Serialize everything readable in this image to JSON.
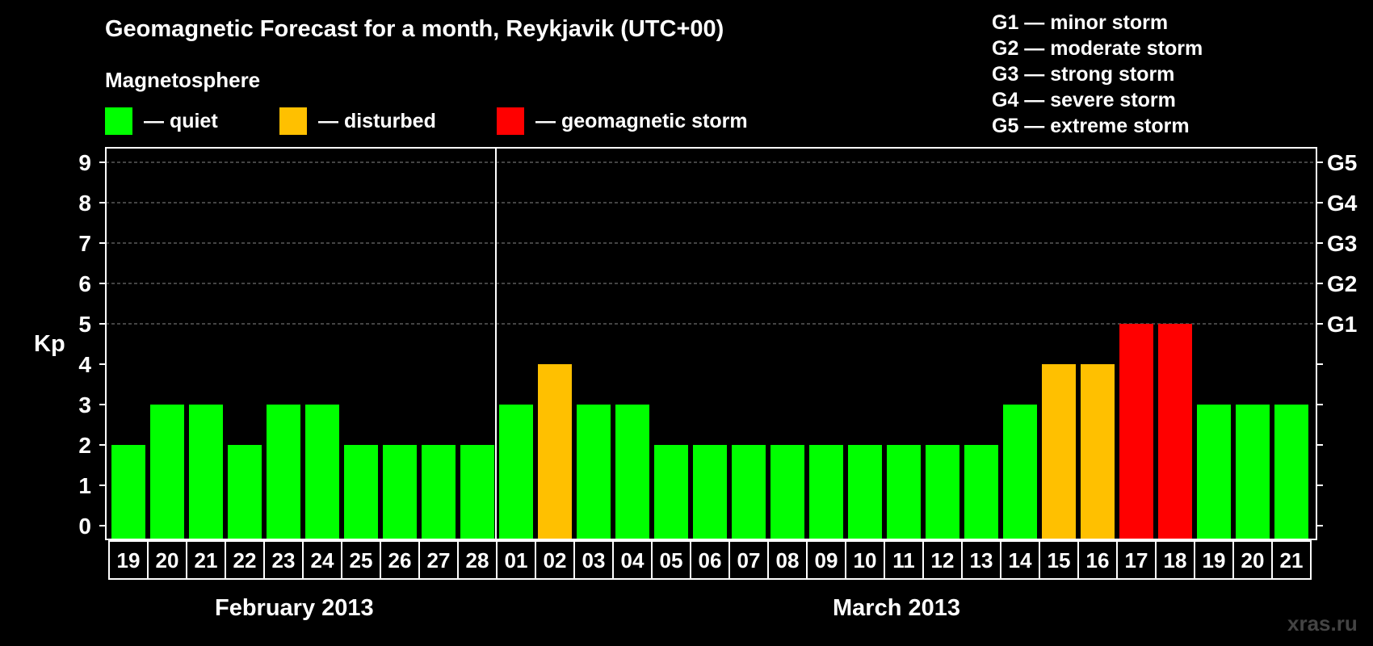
{
  "title": "Geomagnetic Forecast for a month, Reykjavik (UTC+00)",
  "legend": {
    "heading": "Magnetosphere",
    "items": [
      {
        "label": "— quiet",
        "color": "#00ff00"
      },
      {
        "label": "— disturbed",
        "color": "#ffc000"
      },
      {
        "label": "— geomagnetic storm",
        "color": "#ff0000"
      }
    ]
  },
  "storm_scale": [
    "G1 — minor storm",
    "G2 — moderate storm",
    "G3 — strong storm",
    "G4 — severe storm",
    "G5 — extreme storm"
  ],
  "months": [
    "February 2013",
    "March 2013"
  ],
  "watermark": "xras.ru",
  "chart_data": {
    "type": "bar",
    "ylabel": "Kp",
    "ylim": [
      0,
      9
    ],
    "grid": true,
    "yticks": [
      0,
      1,
      2,
      3,
      4,
      5,
      6,
      7,
      8,
      9
    ],
    "right_labels": [
      {
        "kp": 5,
        "label": "G1"
      },
      {
        "kp": 6,
        "label": "G2"
      },
      {
        "kp": 7,
        "label": "G3"
      },
      {
        "kp": 8,
        "label": "G4"
      },
      {
        "kp": 9,
        "label": "G5"
      }
    ],
    "categories": [
      "19",
      "20",
      "21",
      "22",
      "23",
      "24",
      "25",
      "26",
      "27",
      "28",
      "01",
      "02",
      "03",
      "04",
      "05",
      "06",
      "07",
      "08",
      "09",
      "10",
      "11",
      "12",
      "13",
      "14",
      "15",
      "16",
      "17",
      "18",
      "19",
      "20",
      "21"
    ],
    "values": [
      2,
      3,
      3,
      2,
      3,
      3,
      2,
      2,
      2,
      2,
      3,
      4,
      3,
      3,
      2,
      2,
      2,
      2,
      2,
      2,
      2,
      2,
      2,
      3,
      4,
      4,
      5,
      5,
      3,
      3,
      3
    ],
    "status": [
      "quiet",
      "quiet",
      "quiet",
      "quiet",
      "quiet",
      "quiet",
      "quiet",
      "quiet",
      "quiet",
      "quiet",
      "quiet",
      "disturbed",
      "quiet",
      "quiet",
      "quiet",
      "quiet",
      "quiet",
      "quiet",
      "quiet",
      "quiet",
      "quiet",
      "quiet",
      "quiet",
      "quiet",
      "disturbed",
      "disturbed",
      "storm",
      "storm",
      "quiet",
      "quiet",
      "quiet"
    ],
    "colors": {
      "quiet": "#00ff00",
      "disturbed": "#ffc000",
      "storm": "#ff0000"
    }
  }
}
